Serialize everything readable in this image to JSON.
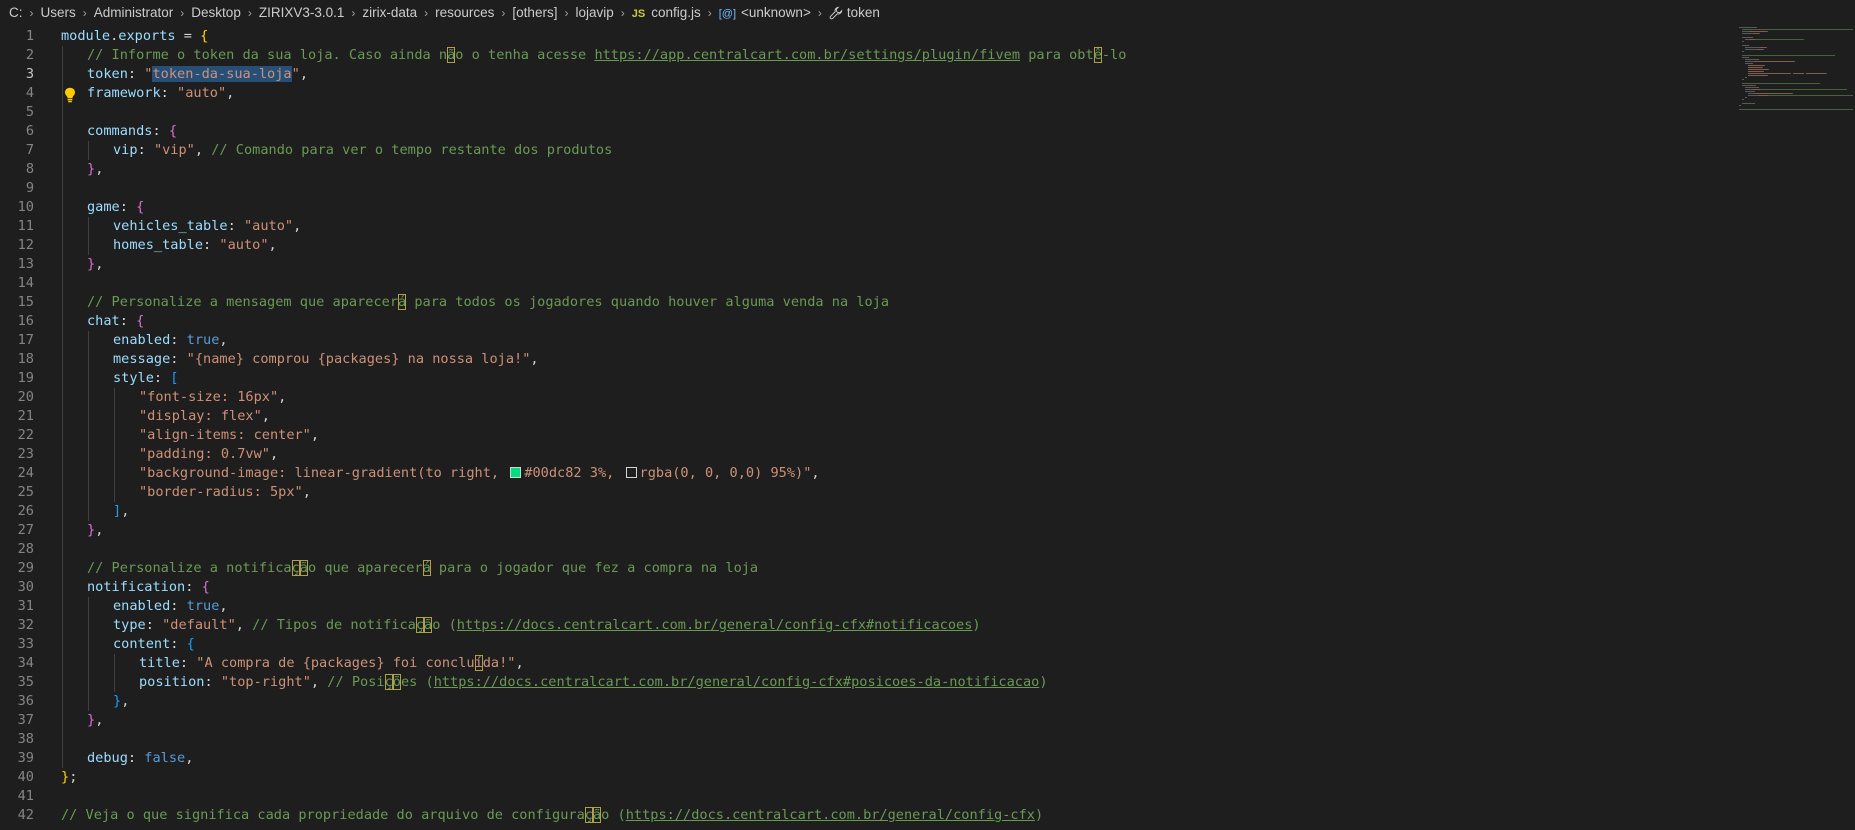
{
  "breadcrumb": [
    {
      "label": "C:"
    },
    {
      "label": "Users"
    },
    {
      "label": "Administrator"
    },
    {
      "label": "Desktop"
    },
    {
      "label": "ZIRIXV3-3.0.1"
    },
    {
      "label": "zirix-data"
    },
    {
      "label": "resources"
    },
    {
      "label": "[others]"
    },
    {
      "label": "lojavip"
    },
    {
      "label": "config.js",
      "icon": "js-file-icon",
      "icon_text": "JS"
    },
    {
      "label": "<unknown>",
      "icon": "symbol-variable-icon",
      "icon_text": "[@]"
    },
    {
      "label": "token",
      "icon": "wrench-icon"
    }
  ],
  "editor": {
    "active_line": 3,
    "colors": {
      "background": "#1e1e1e",
      "keyword": "#569cd6",
      "variable": "#9cdcfe",
      "string": "#ce9178",
      "comment": "#6a9955",
      "selection": "#264f78"
    },
    "lines": [
      {
        "n": "1",
        "i": 0,
        "t": [
          [
            "var",
            "module"
          ],
          [
            "pun",
            "."
          ],
          [
            "var",
            "exports"
          ],
          [
            "pun",
            " = "
          ],
          [
            "br1",
            "{"
          ]
        ]
      },
      {
        "n": "2",
        "i": 1,
        "t": [
          [
            "cm",
            "// Informe o token da sua loja. Caso ainda n"
          ],
          [
            "cm ubox",
            "ã"
          ],
          [
            "cm",
            "o o tenha acesse "
          ],
          [
            "cm url",
            "https://app.centralcart.com.br/settings/plugin/fivem"
          ],
          [
            "cm",
            " para obt"
          ],
          [
            "cm ubox",
            "ê"
          ],
          [
            "cm",
            "-lo"
          ]
        ]
      },
      {
        "n": "3",
        "i": 1,
        "t": [
          [
            "var",
            "token"
          ],
          [
            "pun",
            ": "
          ],
          [
            "str",
            "\""
          ],
          [
            "str sel",
            "token-da-sua-loja"
          ],
          [
            "str",
            "\""
          ],
          [
            "pun",
            ","
          ]
        ]
      },
      {
        "n": "4",
        "i": 1,
        "t": [
          [
            "var",
            "framework"
          ],
          [
            "pun",
            ": "
          ],
          [
            "str",
            "\"auto\""
          ],
          [
            "pun",
            ","
          ]
        ]
      },
      {
        "n": "5",
        "i": 0,
        "t": []
      },
      {
        "n": "6",
        "i": 1,
        "t": [
          [
            "var",
            "commands"
          ],
          [
            "pun",
            ": "
          ],
          [
            "br2",
            "{"
          ]
        ]
      },
      {
        "n": "7",
        "i": 2,
        "t": [
          [
            "var",
            "vip"
          ],
          [
            "pun",
            ": "
          ],
          [
            "str",
            "\"vip\""
          ],
          [
            "pun",
            ", "
          ],
          [
            "cm",
            "// Comando para ver o tempo restante dos produtos"
          ]
        ]
      },
      {
        "n": "8",
        "i": 1,
        "t": [
          [
            "br2",
            "}"
          ],
          [
            "pun",
            ","
          ]
        ]
      },
      {
        "n": "9",
        "i": 0,
        "t": []
      },
      {
        "n": "10",
        "i": 1,
        "t": [
          [
            "var",
            "game"
          ],
          [
            "pun",
            ": "
          ],
          [
            "br2",
            "{"
          ]
        ]
      },
      {
        "n": "11",
        "i": 2,
        "t": [
          [
            "var",
            "vehicles_table"
          ],
          [
            "pun",
            ": "
          ],
          [
            "str",
            "\"auto\""
          ],
          [
            "pun",
            ","
          ]
        ]
      },
      {
        "n": "12",
        "i": 2,
        "t": [
          [
            "var",
            "homes_table"
          ],
          [
            "pun",
            ": "
          ],
          [
            "str",
            "\"auto\""
          ],
          [
            "pun",
            ","
          ]
        ]
      },
      {
        "n": "13",
        "i": 1,
        "t": [
          [
            "br2",
            "}"
          ],
          [
            "pun",
            ","
          ]
        ]
      },
      {
        "n": "14",
        "i": 0,
        "t": []
      },
      {
        "n": "15",
        "i": 1,
        "t": [
          [
            "cm",
            "// Personalize a mensagem que aparecer"
          ],
          [
            "cm ubox",
            "á"
          ],
          [
            "cm",
            " para todos os jogadores quando houver alguma venda na loja"
          ]
        ]
      },
      {
        "n": "16",
        "i": 1,
        "t": [
          [
            "var",
            "chat"
          ],
          [
            "pun",
            ": "
          ],
          [
            "br2",
            "{"
          ]
        ]
      },
      {
        "n": "17",
        "i": 2,
        "t": [
          [
            "var",
            "enabled"
          ],
          [
            "pun",
            ": "
          ],
          [
            "kw",
            "true"
          ],
          [
            "pun",
            ","
          ]
        ]
      },
      {
        "n": "18",
        "i": 2,
        "t": [
          [
            "var",
            "message"
          ],
          [
            "pun",
            ": "
          ],
          [
            "str",
            "\"{name} comprou {packages} na nossa loja!\""
          ],
          [
            "pun",
            ","
          ]
        ]
      },
      {
        "n": "19",
        "i": 2,
        "t": [
          [
            "var",
            "style"
          ],
          [
            "pun",
            ": "
          ],
          [
            "br3",
            "["
          ]
        ]
      },
      {
        "n": "20",
        "i": 3,
        "t": [
          [
            "str",
            "\"font-size: 16px\""
          ],
          [
            "pun",
            ","
          ]
        ]
      },
      {
        "n": "21",
        "i": 3,
        "t": [
          [
            "str",
            "\"display: flex\""
          ],
          [
            "pun",
            ","
          ]
        ]
      },
      {
        "n": "22",
        "i": 3,
        "t": [
          [
            "str",
            "\"align-items: center\""
          ],
          [
            "pun",
            ","
          ]
        ]
      },
      {
        "n": "23",
        "i": 3,
        "t": [
          [
            "str",
            "\"padding: 0.7vw\""
          ],
          [
            "pun",
            ","
          ]
        ]
      },
      {
        "n": "24",
        "i": 3,
        "t": [
          [
            "str",
            "\"background-image: linear-gradient(to right, "
          ],
          [
            "swatch",
            "#00dc82"
          ],
          [
            "str",
            "#00dc82 3%, "
          ],
          [
            "swatch",
            "transparent"
          ],
          [
            "str",
            "rgba(0, 0, 0,0) 95%)\""
          ],
          [
            "pun",
            ","
          ]
        ]
      },
      {
        "n": "25",
        "i": 3,
        "t": [
          [
            "str",
            "\"border-radius: 5px\""
          ],
          [
            "pun",
            ","
          ]
        ]
      },
      {
        "n": "26",
        "i": 2,
        "t": [
          [
            "br3",
            "]"
          ],
          [
            "pun",
            ","
          ]
        ]
      },
      {
        "n": "27",
        "i": 1,
        "t": [
          [
            "br2",
            "}"
          ],
          [
            "pun",
            ","
          ]
        ]
      },
      {
        "n": "28",
        "i": 0,
        "t": []
      },
      {
        "n": "29",
        "i": 1,
        "t": [
          [
            "cm",
            "// Personalize a notifica"
          ],
          [
            "cm ubox",
            "ç"
          ],
          [
            "cm ubox",
            "ã"
          ],
          [
            "cm",
            "o que aparecer"
          ],
          [
            "cm ubox",
            "á"
          ],
          [
            "cm",
            " para o jogador que fez a compra na loja"
          ]
        ]
      },
      {
        "n": "30",
        "i": 1,
        "t": [
          [
            "var",
            "notification"
          ],
          [
            "pun",
            ": "
          ],
          [
            "br2",
            "{"
          ]
        ]
      },
      {
        "n": "31",
        "i": 2,
        "t": [
          [
            "var",
            "enabled"
          ],
          [
            "pun",
            ": "
          ],
          [
            "kw",
            "true"
          ],
          [
            "pun",
            ","
          ]
        ]
      },
      {
        "n": "32",
        "i": 2,
        "t": [
          [
            "var",
            "type"
          ],
          [
            "pun",
            ": "
          ],
          [
            "str",
            "\"default\""
          ],
          [
            "pun",
            ", "
          ],
          [
            "cm",
            "// Tipos de notifica"
          ],
          [
            "cm ubox",
            "ç"
          ],
          [
            "cm ubox",
            "ã"
          ],
          [
            "cm",
            "o ("
          ],
          [
            "cm url",
            "https://docs.centralcart.com.br/general/config-cfx#notificacoes"
          ],
          [
            "cm",
            ")"
          ]
        ]
      },
      {
        "n": "33",
        "i": 2,
        "t": [
          [
            "var",
            "content"
          ],
          [
            "pun",
            ": "
          ],
          [
            "br3",
            "{"
          ]
        ]
      },
      {
        "n": "34",
        "i": 3,
        "t": [
          [
            "var",
            "title"
          ],
          [
            "pun",
            ": "
          ],
          [
            "str",
            "\"A compra de {packages} foi conclu"
          ],
          [
            "str ubox",
            "í"
          ],
          [
            "str",
            "da!\""
          ],
          [
            "pun",
            ","
          ]
        ]
      },
      {
        "n": "35",
        "i": 3,
        "t": [
          [
            "var",
            "position"
          ],
          [
            "pun",
            ": "
          ],
          [
            "str",
            "\"top-right\""
          ],
          [
            "pun",
            ", "
          ],
          [
            "cm",
            "// Posi"
          ],
          [
            "cm ubox",
            "ç"
          ],
          [
            "cm ubox",
            "õ"
          ],
          [
            "cm",
            "es ("
          ],
          [
            "cm url",
            "https://docs.centralcart.com.br/general/config-cfx#posicoes-da-notificacao"
          ],
          [
            "cm",
            ")"
          ]
        ]
      },
      {
        "n": "36",
        "i": 2,
        "t": [
          [
            "br3",
            "}"
          ],
          [
            "pun",
            ","
          ]
        ]
      },
      {
        "n": "37",
        "i": 1,
        "t": [
          [
            "br2",
            "}"
          ],
          [
            "pun",
            ","
          ]
        ]
      },
      {
        "n": "38",
        "i": 0,
        "t": []
      },
      {
        "n": "39",
        "i": 1,
        "t": [
          [
            "var",
            "debug"
          ],
          [
            "pun",
            ": "
          ],
          [
            "kw",
            "false"
          ],
          [
            "pun",
            ","
          ]
        ]
      },
      {
        "n": "40",
        "i": 0,
        "t": [
          [
            "br1",
            "}"
          ],
          [
            "pun",
            ";"
          ]
        ]
      },
      {
        "n": "41",
        "i": 0,
        "t": []
      },
      {
        "n": "42",
        "i": 0,
        "t": [
          [
            "cm",
            "// Veja o que significa cada propriedade do arquivo de configura"
          ],
          [
            "cm ubox",
            "ç"
          ],
          [
            "cm ubox",
            "ã"
          ],
          [
            "cm",
            "o ("
          ],
          [
            "cm url",
            "https://docs.centralcart.com.br/general/config-cfx"
          ],
          [
            "cm",
            ")"
          ]
        ]
      }
    ]
  }
}
